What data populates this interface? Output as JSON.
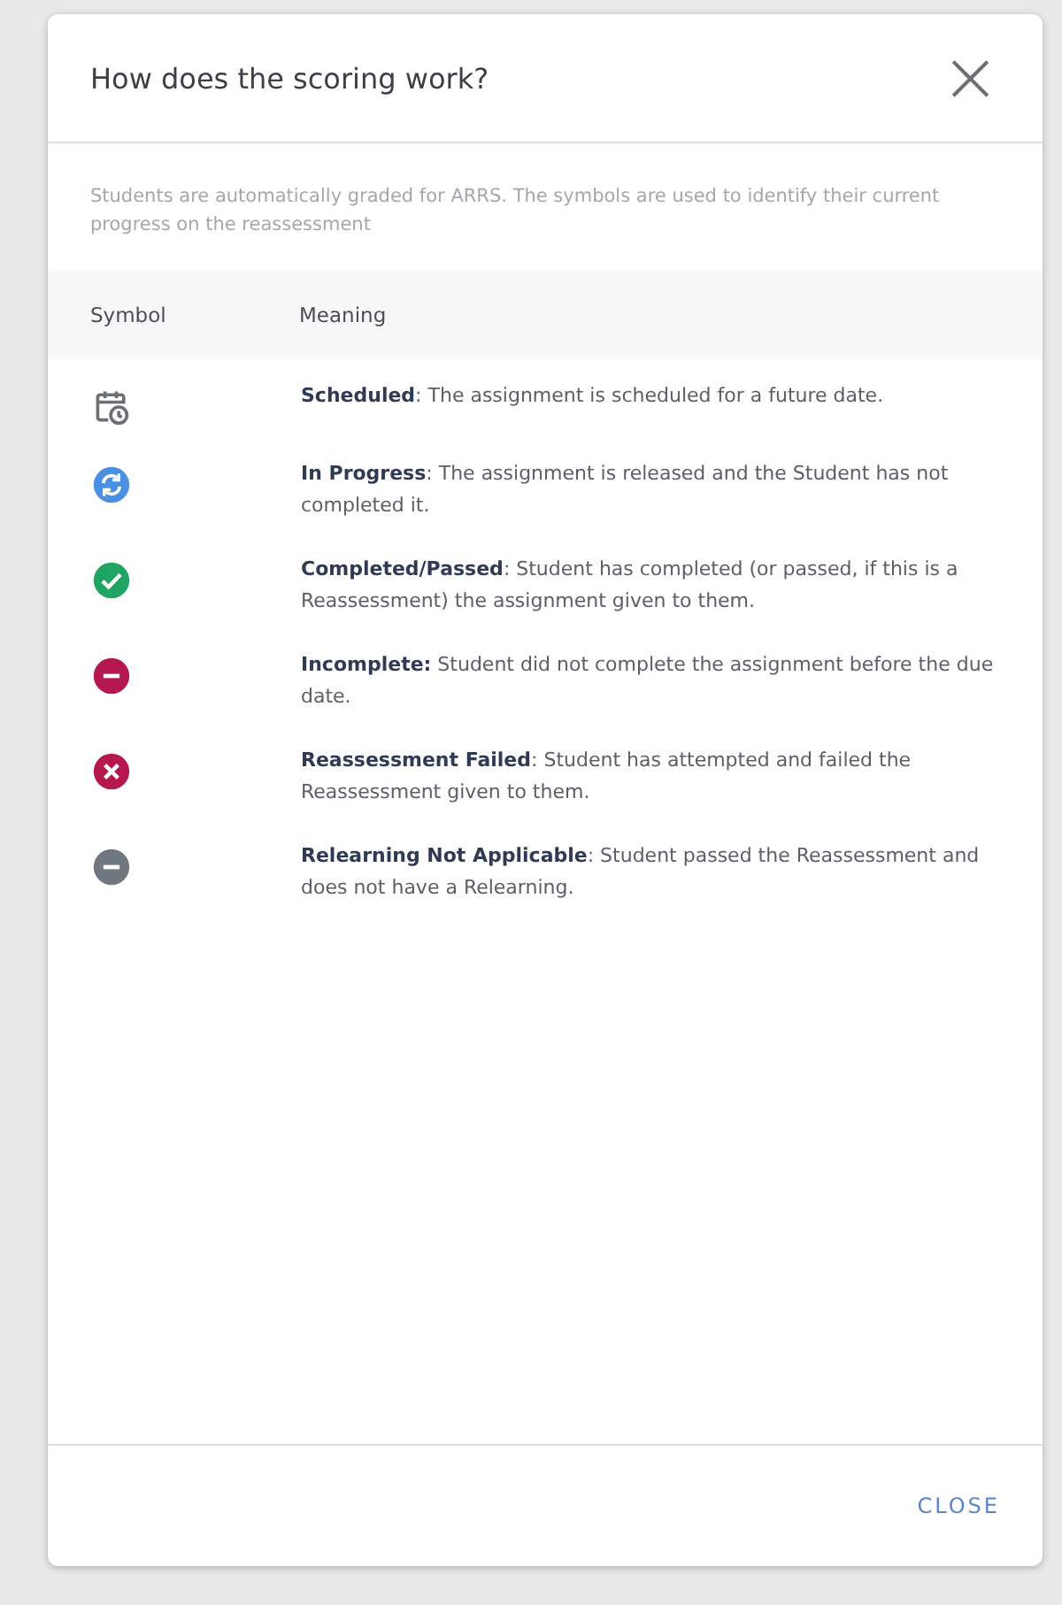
{
  "dialog": {
    "title": "How does the scoring work?",
    "close_icon": "×"
  },
  "description": "Students are automatically graded for ARRS. The symbols are used to identify their current progress on the reassessment",
  "table": {
    "columns": [
      "Symbol",
      "Meaning"
    ],
    "rows": [
      {
        "kind": "calendar",
        "color": "#6b7075",
        "text": "**Scheduled**: The assignment is scheduled for a future date."
      },
      {
        "kind": "sync",
        "color": "#4a90e2",
        "text": "**In Progress**: The assignment is released and the Student has not completed it."
      },
      {
        "kind": "check",
        "color": "#1fa463",
        "text": "**Completed/Passed**: Student has completed (or passed, if this is a Reassessment) the assignment given to them."
      },
      {
        "kind": "minus",
        "color": "#b5174f",
        "text": "**Incomplete:** Student did not complete the assignment before the due date."
      },
      {
        "kind": "cross",
        "color": "#b5174f",
        "text": "**Reassessment Failed**: Student has attempted and failed the Reassessment given to them."
      },
      {
        "kind": "minus",
        "color": "#6f7780",
        "text": "**Relearning Not Applicable**: Student passed the Reassessment and does not have a Relearning."
      }
    ]
  },
  "footer": {
    "button": "CLOSE"
  }
}
